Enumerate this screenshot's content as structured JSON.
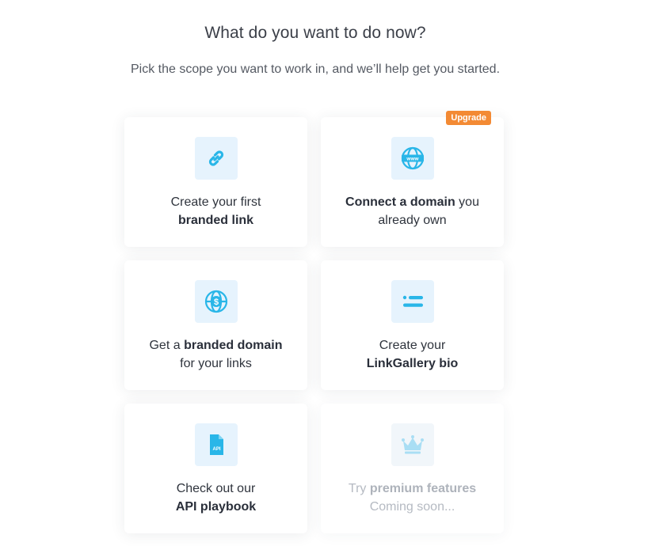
{
  "header": {
    "title": "What do you want to do now?",
    "subtitle": "Pick the scope you want to work in, and we’ll help get you started."
  },
  "cards": [
    {
      "line1_pre": "Create your first",
      "line1_bold": "",
      "line1_post": "",
      "line2_pre": "",
      "line2_bold": "branded link",
      "line2_post": "",
      "icon": "link-icon"
    },
    {
      "line1_pre": "",
      "line1_bold": "Connect a domain",
      "line1_post": " you",
      "line2_pre": "already own",
      "line2_bold": "",
      "line2_post": "",
      "icon": "www-globe-icon",
      "badge": "Upgrade"
    },
    {
      "line1_pre": "Get a ",
      "line1_bold": "branded domain",
      "line1_post": "",
      "line2_pre": "for your links",
      "line2_bold": "",
      "line2_post": "",
      "icon": "dollar-globe-icon"
    },
    {
      "line1_pre": "Create your",
      "line1_bold": "",
      "line1_post": "",
      "line2_pre": "",
      "line2_bold": "LinkGallery bio",
      "line2_post": "",
      "icon": "list-icon"
    },
    {
      "line1_pre": "Check out our",
      "line1_bold": "",
      "line1_post": "",
      "line2_pre": "",
      "line2_bold": "API playbook",
      "line2_post": "",
      "icon": "api-file-icon",
      "icon_text": "API"
    },
    {
      "line1_pre": "Try ",
      "line1_bold": "premium features",
      "line1_post": "",
      "line2_pre": "Coming soon...",
      "line2_bold": "",
      "line2_post": "",
      "icon": "crown-icon"
    }
  ],
  "colors": {
    "icon_blue": "#29b6e8",
    "icon_bg": "#e6f3fd",
    "badge": "#f38a34"
  }
}
